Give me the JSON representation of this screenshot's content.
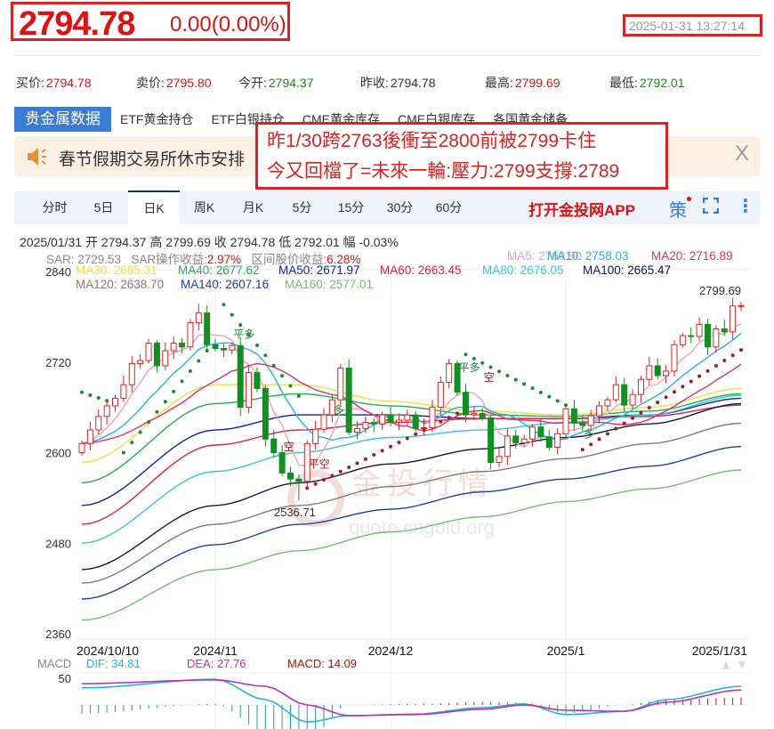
{
  "header": {
    "price": "2794.78",
    "change": "0.00(0.00%)",
    "datetime": "2025-01-31 13:27:14"
  },
  "quotes": [
    {
      "label": "买价:",
      "value": "2794.78",
      "color": "red"
    },
    {
      "label": "卖价:",
      "value": "2795.80",
      "color": "red"
    },
    {
      "label": "今开:",
      "value": "2794.37",
      "color": "green"
    },
    {
      "label": "昨收:",
      "value": "2794.78",
      "color": ""
    },
    {
      "label": "最高:",
      "value": "2799.69",
      "color": "red"
    },
    {
      "label": "最低:",
      "value": "2792.01",
      "color": "green"
    }
  ],
  "tabs": [
    "贵金属数据",
    "ETF黄金持仓",
    "ETF白银持仓",
    "CME黄金库存",
    "CME白银库存",
    "各国黄金储备"
  ],
  "notice": {
    "text": "春节假期交易所休市安排",
    "close": "X"
  },
  "annotation": {
    "line1": "昨1/30跨2763後衝至2800前被2799卡住",
    "line2": "今又回檔了=未來一輪:壓力:2799支撐:2789"
  },
  "periods": [
    "分时",
    "5日",
    "日K",
    "周K",
    "月K",
    "5分",
    "15分",
    "30分",
    "60分"
  ],
  "active_period": "日K",
  "app_link": "打开金投网APP",
  "strategy_icon": "策",
  "info": {
    "date": "2025/01/31",
    "open_label": "开",
    "open": "2794.37",
    "high_label": "高",
    "high": "2799.69",
    "close_label": "收",
    "close": "2794.78",
    "low_label": "低",
    "low": "2792.01",
    "amp_label": "幅",
    "amp": "-0.03%"
  },
  "legend": {
    "sar": "SAR: 2729.53",
    "sar_gain_label": "SAR操作收益:",
    "sar_gain": "2.97%",
    "range_gain_label": "区间股价收益:",
    "range_gain": "6.28%",
    "ma": [
      {
        "text": "MA5: 2769.90",
        "color": "#f0a0b8"
      },
      {
        "text": "MA10: 2758.03",
        "color": "#20b8d8"
      },
      {
        "text": "MA20: 2716.89",
        "color": "#e03070"
      },
      {
        "text": "MA30: 2685.31",
        "color": "#f0e040"
      },
      {
        "text": "MA40: 2677.62",
        "color": "#20b050"
      },
      {
        "text": "MA50: 2671.97",
        "color": "#1020b0"
      },
      {
        "text": "MA60: 2663.45",
        "color": "#e02040"
      },
      {
        "text": "MA80: 2676.05",
        "color": "#30c8d8"
      },
      {
        "text": "MA100: 2665.47",
        "color": "#101848"
      },
      {
        "text": "MA120: 2638.70",
        "color": "#8a7870"
      },
      {
        "text": "MA140: 2607.16",
        "color": "#2040a0"
      },
      {
        "text": "MA160: 2577.01",
        "color": "#70c070"
      }
    ]
  },
  "chart_data": {
    "type": "candlestick",
    "yticks": [
      "2840",
      "2720",
      "2600",
      "2480",
      "2360"
    ],
    "ylim": [
      2360,
      2840
    ],
    "xlabels": [
      {
        "text": "2024/10/10",
        "index": 0
      },
      {
        "text": "2024/11",
        "index": 16
      },
      {
        "text": "2024/12",
        "index": 37
      },
      {
        "text": "2025/1",
        "index": 58
      },
      {
        "text": "2025/1/31",
        "index": 79
      }
    ],
    "closes": [
      2612,
      2630,
      2648,
      2662,
      2672,
      2690,
      2718,
      2722,
      2745,
      2715,
      2735,
      2745,
      2740,
      2772,
      2785,
      2743,
      2738,
      2736,
      2742,
      2660,
      2706,
      2685,
      2618,
      2600,
      2573,
      2565,
      2562,
      2612,
      2631,
      2650,
      2670,
      2712,
      2627,
      2632,
      2640,
      2638,
      2650,
      2640,
      2643,
      2650,
      2632,
      2633,
      2660,
      2693,
      2718,
      2680,
      2650,
      2652,
      2646,
      2587,
      2595,
      2622,
      2613,
      2618,
      2634,
      2621,
      2607,
      2625,
      2658,
      2640,
      2636,
      2649,
      2662,
      2670,
      2690,
      2663,
      2677,
      2697,
      2715,
      2702,
      2708,
      2743,
      2755,
      2754,
      2770,
      2740,
      2764,
      2760,
      2794.37,
      2794.78
    ],
    "first_open": 2600,
    "extremes": [
      {
        "index": 26,
        "low": 2536.71,
        "label": "2536.71"
      },
      {
        "index": 79,
        "high": 2799.69,
        "label": "2799.69"
      }
    ],
    "ma_anchor_index": [
      0,
      16,
      26,
      37,
      48,
      58,
      68,
      79
    ],
    "ma_series": [
      {
        "name": "MA30",
        "values": [
          2587,
          2690,
          2690,
          2668,
          2655,
          2650,
          2660,
          2685
        ]
      },
      {
        "name": "MA40",
        "values": [
          2560,
          2665,
          2678,
          2662,
          2650,
          2648,
          2655,
          2678
        ]
      },
      {
        "name": "MA50",
        "values": [
          2530,
          2630,
          2650,
          2650,
          2645,
          2645,
          2650,
          2672
        ]
      },
      {
        "name": "MA60",
        "values": [
          2505,
          2610,
          2630,
          2640,
          2645,
          2645,
          2648,
          2663
        ]
      },
      {
        "name": "MA80",
        "values": [
          2480,
          2575,
          2600,
          2620,
          2630,
          2640,
          2650,
          2676
        ]
      },
      {
        "name": "MA100",
        "values": [
          2445,
          2530,
          2560,
          2585,
          2605,
          2620,
          2638,
          2665
        ]
      },
      {
        "name": "MA120",
        "values": [
          2427,
          2505,
          2530,
          2555,
          2575,
          2592,
          2612,
          2639
        ]
      },
      {
        "name": "MA140",
        "values": [
          2406,
          2478,
          2505,
          2525,
          2548,
          2565,
          2582,
          2608
        ]
      },
      {
        "name": "MA160",
        "values": [
          2378,
          2445,
          2470,
          2495,
          2515,
          2535,
          2552,
          2577
        ]
      }
    ],
    "sar_segments": [
      [
        0,
        4,
        2680,
        2665
      ],
      [
        5,
        15,
        2600,
        2735
      ],
      [
        17,
        26,
        2796,
        2675
      ],
      [
        27,
        45,
        2553,
        2652
      ],
      [
        46,
        58,
        2730,
        2663
      ],
      [
        60,
        79,
        2604,
        2736
      ]
    ],
    "signals": [
      {
        "text": "平多",
        "index": 19,
        "value": 2752
      },
      {
        "text": "空",
        "index": 25,
        "value": 2603
      },
      {
        "text": "平空",
        "index": 28,
        "value": 2580
      },
      {
        "text": "多",
        "index": 31,
        "value": 2652
      },
      {
        "text": "平多",
        "index": 46,
        "value": 2708
      },
      {
        "text": "空",
        "index": 49,
        "value": 2695
      },
      {
        "text": "多",
        "index": 61,
        "value": 2620
      }
    ],
    "macd": {
      "label": "MACD",
      "dif_label": "DIF: 34.81",
      "dea_label": "DEA: 27.76",
      "macd_label": "MACD: 14.09",
      "ytick": "50",
      "ylim": [
        -50,
        50
      ],
      "anchor_index": [
        0,
        16,
        22,
        27,
        32,
        40,
        48,
        53,
        58,
        65,
        70,
        79
      ],
      "dif": [
        32,
        48,
        10,
        -32,
        -20,
        -17,
        -5,
        2,
        -18,
        -12,
        10,
        35
      ],
      "dea": [
        40,
        47,
        35,
        0,
        -20,
        -18,
        -8,
        0,
        -10,
        -12,
        5,
        28
      ]
    },
    "watermark": {
      "name": "金投行情",
      "url": "quote.cngold.org"
    }
  }
}
